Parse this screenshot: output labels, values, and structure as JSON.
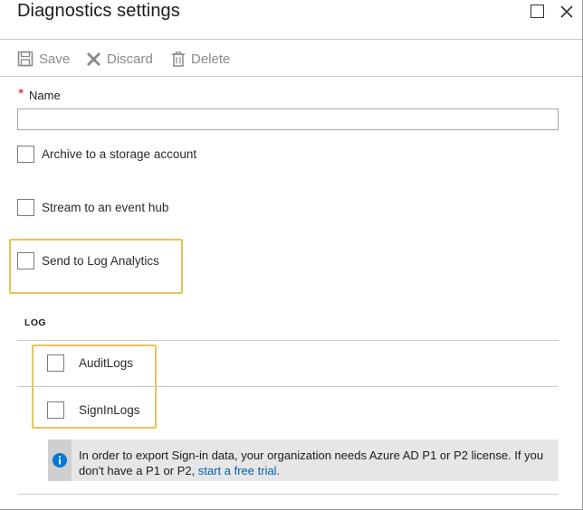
{
  "blade": {
    "title": "Diagnostics settings"
  },
  "toolbar": {
    "save_label": "Save",
    "discard_label": "Discard",
    "delete_label": "Delete"
  },
  "form": {
    "name": {
      "required_marker": "*",
      "label": "Name",
      "value": "",
      "placeholder": ""
    },
    "destinations": [
      {
        "label": "Archive to a storage account",
        "checked": false
      },
      {
        "label": "Stream to an event hub",
        "checked": false
      },
      {
        "label": "Send to Log Analytics",
        "checked": false
      }
    ]
  },
  "log": {
    "header": "LOG",
    "categories": [
      {
        "label": "AuditLogs",
        "checked": false
      },
      {
        "label": "SignInLogs",
        "checked": false
      }
    ]
  },
  "info": {
    "text": "In order to export Sign-in data, your organization needs Azure AD P1 or P2 license. If you don't have a P1 or P2,",
    "link_text": "start a free trial."
  },
  "colors": {
    "highlight": "#e6c259",
    "info_icon": "#0078d4",
    "link": "#0062ad",
    "required": "#e00b1c",
    "disabled_text": "#8a8a8a"
  }
}
